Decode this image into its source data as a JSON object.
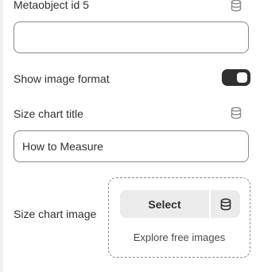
{
  "fields": {
    "metaobject_id": {
      "label": "Metaobject id 5",
      "value": ""
    },
    "show_image_format": {
      "label": "Show image format",
      "enabled": true
    },
    "size_chart_title": {
      "label": "Size chart title",
      "value": "How to Measure"
    },
    "size_chart_image": {
      "label": "Size chart image",
      "select_label": "Select",
      "explore_label": "Explore free images"
    }
  },
  "icons": {
    "dynamic_source": "database-icon"
  },
  "colors": {
    "toggle_on": "#303030",
    "input_border": "#8a8a8a",
    "button_bg": "#ebebeb"
  }
}
